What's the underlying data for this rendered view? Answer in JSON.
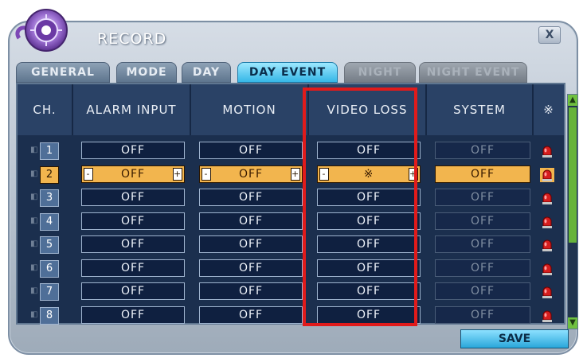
{
  "window": {
    "title": "RECORD",
    "close_label": "X"
  },
  "tabs": [
    {
      "label": "GENERAL",
      "state": "inactive"
    },
    {
      "label": "MODE",
      "state": "inactive"
    },
    {
      "label": "DAY",
      "state": "inactive"
    },
    {
      "label": "DAY EVENT",
      "state": "active"
    },
    {
      "label": "NIGHT",
      "state": "disabled"
    },
    {
      "label": "NIGHT EVENT",
      "state": "disabled"
    }
  ],
  "columns": [
    "CH.",
    "ALARM INPUT",
    "MOTION",
    "VIDEO LOSS",
    "SYSTEM",
    "※"
  ],
  "rows": [
    {
      "ch": "1",
      "alarm": "OFF",
      "motion": "OFF",
      "video_loss": "OFF",
      "system": "OFF",
      "selected": false
    },
    {
      "ch": "2",
      "alarm": "OFF",
      "motion": "OFF",
      "video_loss": "※",
      "system": "OFF",
      "selected": true
    },
    {
      "ch": "3",
      "alarm": "OFF",
      "motion": "OFF",
      "video_loss": "OFF",
      "system": "OFF",
      "selected": false
    },
    {
      "ch": "4",
      "alarm": "OFF",
      "motion": "OFF",
      "video_loss": "OFF",
      "system": "OFF",
      "selected": false
    },
    {
      "ch": "5",
      "alarm": "OFF",
      "motion": "OFF",
      "video_loss": "OFF",
      "system": "OFF",
      "selected": false
    },
    {
      "ch": "6",
      "alarm": "OFF",
      "motion": "OFF",
      "video_loss": "OFF",
      "system": "OFF",
      "selected": false
    },
    {
      "ch": "7",
      "alarm": "OFF",
      "motion": "OFF",
      "video_loss": "OFF",
      "system": "OFF",
      "selected": false
    },
    {
      "ch": "8",
      "alarm": "OFF",
      "motion": "OFF",
      "video_loss": "OFF",
      "system": "OFF",
      "selected": false
    }
  ],
  "stepper": {
    "minus": "-",
    "plus": "+"
  },
  "save_label": "SAVE",
  "colors": {
    "accent_selected": "#f2b54e",
    "highlight_box": "#e11b1b",
    "active_tab": "#36b7e7"
  },
  "icons": {
    "channel": "camera-plug-icon",
    "alarm": "red-siren-icon",
    "logo": "record-disc-logo-icon"
  }
}
